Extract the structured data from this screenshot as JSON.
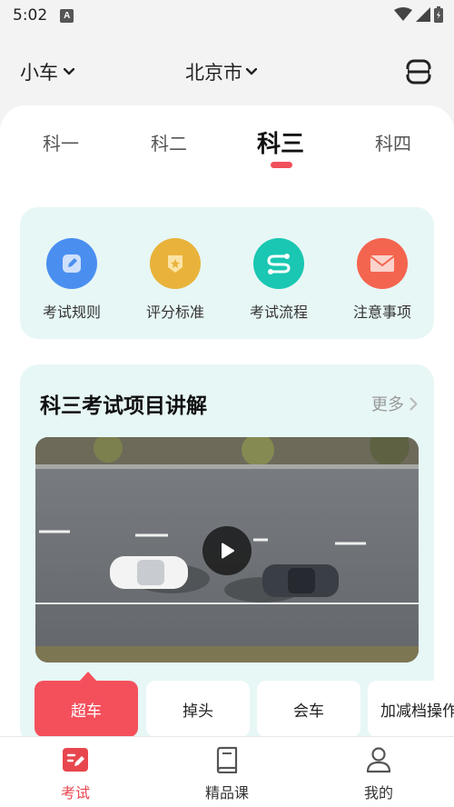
{
  "status_bar": {
    "time": "5:02",
    "notification": "A"
  },
  "header": {
    "vehicle_type": "小车",
    "city": "北京市"
  },
  "tabs": [
    {
      "label": "科一",
      "active": false
    },
    {
      "label": "科二",
      "active": false
    },
    {
      "label": "科三",
      "active": true
    },
    {
      "label": "科四",
      "active": false
    }
  ],
  "quick_actions": [
    {
      "label": "考试规则",
      "icon": "edit-doc-icon",
      "color": "#4a8ff0"
    },
    {
      "label": "评分标准",
      "icon": "badge-icon",
      "color": "#e9b33b"
    },
    {
      "label": "考试流程",
      "icon": "flow-icon",
      "color": "#19c7b2"
    },
    {
      "label": "注意事项",
      "icon": "mail-icon",
      "color": "#f4654f"
    }
  ],
  "lecture": {
    "title": "科三考试项目讲解",
    "more": "更多",
    "video": {
      "icon": "play-icon"
    },
    "chips": [
      {
        "label": "超车",
        "active": true
      },
      {
        "label": "掉头",
        "active": false
      },
      {
        "label": "会车",
        "active": false
      },
      {
        "label": "加减档操作",
        "active": false
      }
    ]
  },
  "bottom_nav": [
    {
      "label": "考试",
      "icon": "exam-icon",
      "active": true
    },
    {
      "label": "精品课",
      "icon": "book-icon",
      "active": false
    },
    {
      "label": "我的",
      "icon": "profile-icon",
      "active": false
    }
  ],
  "colors": {
    "accent": "#f0505a",
    "card_bg": "#e7f7f6"
  }
}
